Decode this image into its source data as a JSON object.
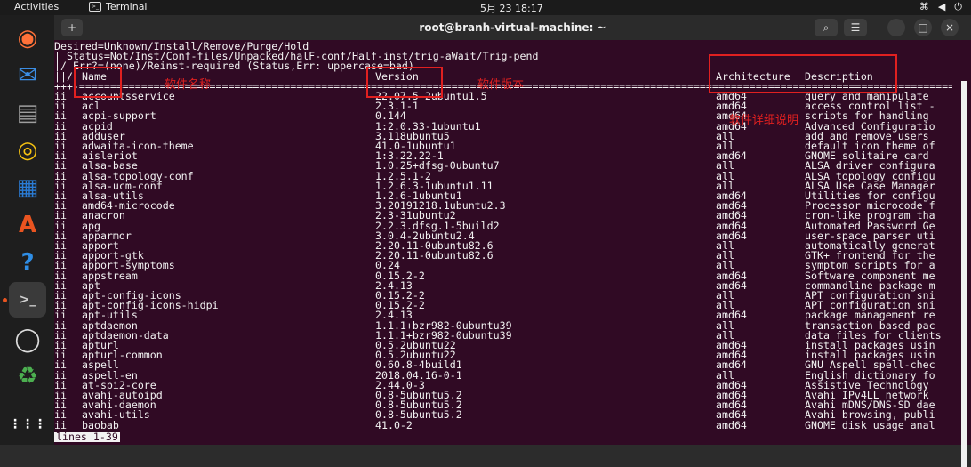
{
  "topbar": {
    "activities": "Activities",
    "app_name": "Terminal",
    "clock": "5月 23 18:17"
  },
  "dock": {
    "items": [
      {
        "icon": "firefox-icon",
        "glyph": "◉",
        "color": "#ff7139"
      },
      {
        "icon": "thunderbird-icon",
        "glyph": "✉",
        "color": "#3b8de3"
      },
      {
        "icon": "files-icon",
        "glyph": "▤",
        "color": "#9e9e9e"
      },
      {
        "icon": "rhythmbox-icon",
        "glyph": "◎",
        "color": "#f5c211"
      },
      {
        "icon": "writer-icon",
        "glyph": "▦",
        "color": "#2a7cd6"
      },
      {
        "icon": "software-icon",
        "glyph": "A",
        "color": "#e95420"
      },
      {
        "icon": "help-icon",
        "glyph": "?",
        "color": "#2f8ee6"
      },
      {
        "icon": "terminal-icon",
        "glyph": ">_",
        "color": "#cfcfcf"
      },
      {
        "icon": "dvd-icon",
        "glyph": "◯",
        "color": "#dcdcdc"
      },
      {
        "icon": "trash-icon",
        "glyph": "♻",
        "color": "#4caf50"
      },
      {
        "icon": "app-grid-icon",
        "glyph": "⋮⋮⋮",
        "color": "#ffffff"
      }
    ]
  },
  "window": {
    "title": "root@branh-virtual-machine: ~"
  },
  "terminal": {
    "header": [
      "Desired=Unknown/Install/Remove/Purge/Hold",
      "| Status=Not/Inst/Conf-files/Unpacked/halF-conf/Half-inst/trig-aWait/Trig-pend",
      "|/ Err?=(none)/Reinst-required (Status,Err: uppercase=bad)"
    ],
    "columns": {
      "prefix": "||/",
      "name": "Name",
      "version": "Version",
      "arch": "Architecture",
      "desc": "Description"
    },
    "separator": "+++-====================================================================================================================================================================",
    "rows": [
      [
        "ii",
        "accountsservice",
        "22.07.5-2ubuntu1.5",
        "amd64",
        "query and manipulate"
      ],
      [
        "ii",
        "acl",
        "2.3.1-1",
        "amd64",
        "access control list -"
      ],
      [
        "ii",
        "acpi-support",
        "0.144",
        "amd64",
        "scripts for handling"
      ],
      [
        "ii",
        "acpid",
        "1:2.0.33-1ubuntu1",
        "amd64",
        "Advanced Configuratio"
      ],
      [
        "ii",
        "adduser",
        "3.118ubuntu5",
        "all",
        "add and remove users"
      ],
      [
        "ii",
        "adwaita-icon-theme",
        "41.0-1ubuntu1",
        "all",
        "default icon theme of"
      ],
      [
        "ii",
        "aisleriot",
        "1:3.22.22-1",
        "amd64",
        "GNOME solitaire card"
      ],
      [
        "ii",
        "alsa-base",
        "1.0.25+dfsg-0ubuntu7",
        "all",
        "ALSA driver configura"
      ],
      [
        "ii",
        "alsa-topology-conf",
        "1.2.5.1-2",
        "all",
        "ALSA topology configu"
      ],
      [
        "ii",
        "alsa-ucm-conf",
        "1.2.6.3-1ubuntu1.11",
        "all",
        "ALSA Use Case Manager"
      ],
      [
        "ii",
        "alsa-utils",
        "1.2.6-1ubuntu1",
        "amd64",
        "Utilities for configu"
      ],
      [
        "ii",
        "amd64-microcode",
        "3.20191218.1ubuntu2.3",
        "amd64",
        "Processor microcode f"
      ],
      [
        "ii",
        "anacron",
        "2.3-31ubuntu2",
        "amd64",
        "cron-like program tha"
      ],
      [
        "ii",
        "apg",
        "2.2.3.dfsg.1-5build2",
        "amd64",
        "Automated Password Ge"
      ],
      [
        "ii",
        "apparmor",
        "3.0.4-2ubuntu2.4",
        "amd64",
        "user-space parser uti"
      ],
      [
        "ii",
        "apport",
        "2.20.11-0ubuntu82.6",
        "all",
        "automatically generat"
      ],
      [
        "ii",
        "apport-gtk",
        "2.20.11-0ubuntu82.6",
        "all",
        "GTK+ frontend for the"
      ],
      [
        "ii",
        "apport-symptoms",
        "0.24",
        "all",
        "symptom scripts for a"
      ],
      [
        "ii",
        "appstream",
        "0.15.2-2",
        "amd64",
        "Software component me"
      ],
      [
        "ii",
        "apt",
        "2.4.13",
        "amd64",
        "commandline package m"
      ],
      [
        "ii",
        "apt-config-icons",
        "0.15.2-2",
        "all",
        "APT configuration sni"
      ],
      [
        "ii",
        "apt-config-icons-hidpi",
        "0.15.2-2",
        "all",
        "APT configuration sni"
      ],
      [
        "ii",
        "apt-utils",
        "2.4.13",
        "amd64",
        "package management re"
      ],
      [
        "ii",
        "aptdaemon",
        "1.1.1+bzr982-0ubuntu39",
        "all",
        "transaction based pac"
      ],
      [
        "ii",
        "aptdaemon-data",
        "1.1.1+bzr982-0ubuntu39",
        "all",
        "data files for clients"
      ],
      [
        "ii",
        "apturl",
        "0.5.2ubuntu22",
        "amd64",
        "install packages usin"
      ],
      [
        "ii",
        "apturl-common",
        "0.5.2ubuntu22",
        "amd64",
        "install packages usin"
      ],
      [
        "ii",
        "aspell",
        "0.60.8-4build1",
        "amd64",
        "GNU Aspell spell-chec"
      ],
      [
        "ii",
        "aspell-en",
        "2018.04.16-0-1",
        "all",
        "English dictionary fo"
      ],
      [
        "ii",
        "at-spi2-core",
        "2.44.0-3",
        "amd64",
        "Assistive Technology"
      ],
      [
        "ii",
        "avahi-autoipd",
        "0.8-5ubuntu5.2",
        "amd64",
        "Avahi IPv4LL network"
      ],
      [
        "ii",
        "avahi-daemon",
        "0.8-5ubuntu5.2",
        "amd64",
        "Avahi mDNS/DNS-SD dae"
      ],
      [
        "ii",
        "avahi-utils",
        "0.8-5ubuntu5.2",
        "amd64",
        "Avahi browsing, publi"
      ],
      [
        "ii",
        "baobab",
        "41.0-2",
        "amd64",
        "GNOME disk usage anal"
      ]
    ],
    "status_line": "lines 1-39"
  },
  "annotations": {
    "name_label": "软件名称",
    "version_label": "软件版本",
    "desc_label": "软件详细说明",
    "color": "#e02020"
  }
}
